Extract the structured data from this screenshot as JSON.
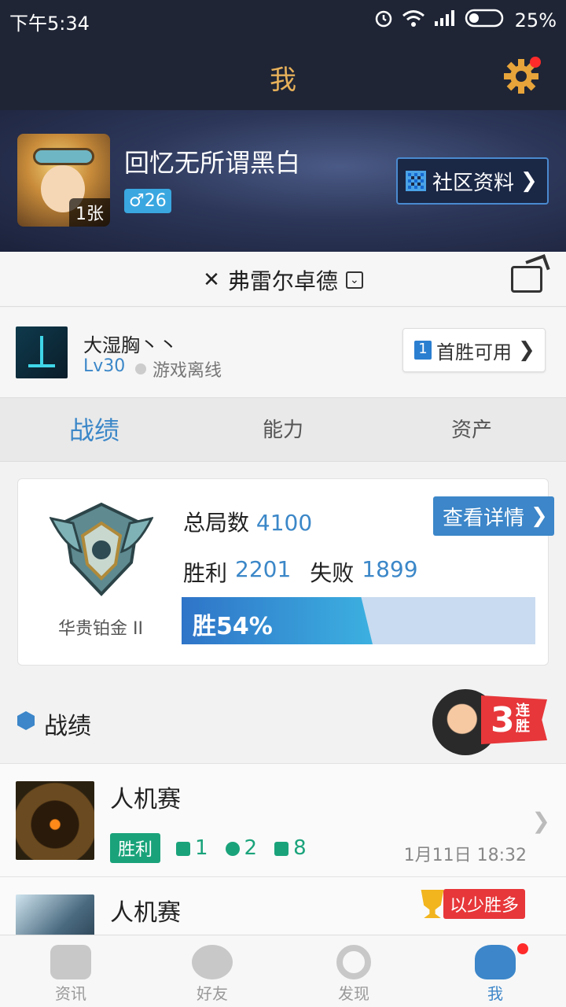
{
  "status_bar": {
    "time": "下午5:34",
    "battery": "25%"
  },
  "header": {
    "title": "我"
  },
  "profile": {
    "nickname": "回忆无所谓黑白",
    "avatar_badge": "1张",
    "gender_level": "♂26",
    "community_button": "社区资料"
  },
  "server": {
    "name": "弗雷尔卓德"
  },
  "account": {
    "name": "大湿胸丶丶",
    "level": "Lv30",
    "status": "游戏离线",
    "first_win_icon": "1",
    "first_win_label": "首胜可用"
  },
  "tabs": [
    {
      "label": "战绩",
      "active": true
    },
    {
      "label": "能力",
      "active": false
    },
    {
      "label": "资产",
      "active": false
    }
  ],
  "stats": {
    "rank": "华贵铂金 II",
    "total_label": "总局数",
    "total": "4100",
    "win_label": "胜利",
    "wins": "2201",
    "loss_label": "失败",
    "losses": "1899",
    "win_rate_text": "胜54%",
    "win_rate": 0.54,
    "detail_button": "查看详情"
  },
  "section": {
    "title": "战绩",
    "streak_number": "3",
    "streak_text": "连胜"
  },
  "matches": [
    {
      "type": "人机赛",
      "result": "胜利",
      "kills": "1",
      "deaths": "2",
      "assists": "8",
      "time": "1月11日 18:32"
    },
    {
      "type": "人机赛",
      "badge": "以少胜多"
    }
  ],
  "bottom_nav": [
    {
      "label": "资讯",
      "icon": "book-icon",
      "active": false
    },
    {
      "label": "好友",
      "icon": "friends-icon",
      "active": false
    },
    {
      "label": "发现",
      "icon": "discover-icon",
      "active": false
    },
    {
      "label": "我",
      "icon": "me-icon",
      "active": true
    }
  ],
  "colors": {
    "accent": "#3c86c9",
    "header_bg": "#1f2535",
    "title_gold": "#e7b15a",
    "win_green": "#1aa37b",
    "alert_red": "#ff2b2b"
  }
}
